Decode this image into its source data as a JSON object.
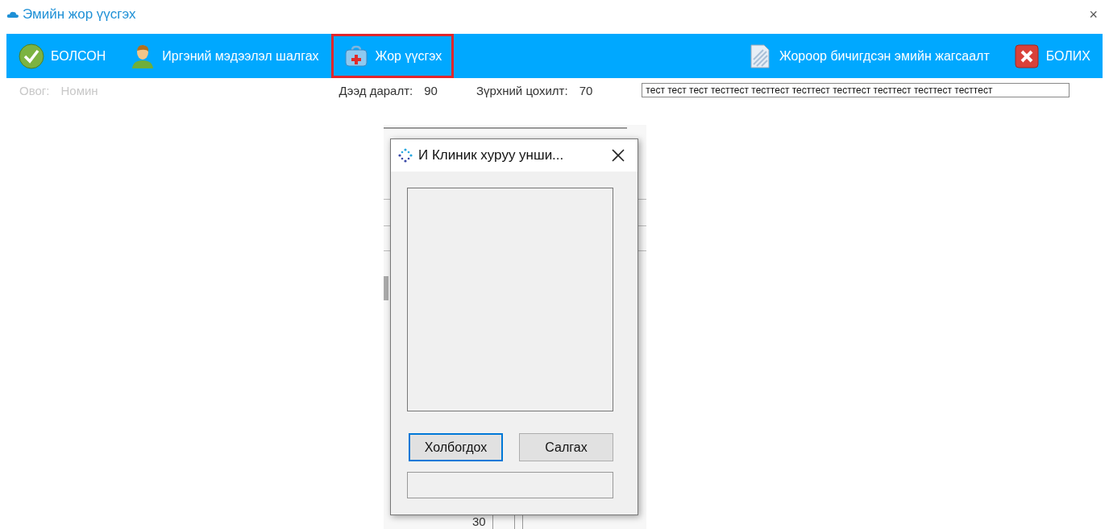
{
  "window": {
    "title": "Эмийн жор үүсгэх",
    "close": "×"
  },
  "toolbar": {
    "left": [
      {
        "kind": "done",
        "label": "БОЛСОН",
        "highlighted": false
      },
      {
        "kind": "person",
        "label": "Иргэний мэдээлэл шалгах",
        "highlighted": false
      },
      {
        "kind": "medkit",
        "label": "Жор үүсгэх",
        "highlighted": true
      }
    ],
    "right": [
      {
        "kind": "document",
        "label": "Жороор бичигдсэн эмийн жагсаалт",
        "highlighted": false
      },
      {
        "kind": "cancel",
        "label": "БОЛИХ",
        "highlighted": false
      }
    ]
  },
  "info": {
    "fields": [
      {
        "label": "Овог:",
        "value": "Номин",
        "faded": true
      },
      {
        "label": "Дээд даралт:",
        "value": "90",
        "faded": false
      },
      {
        "label": "Зүрхний цохилт:",
        "value": "70",
        "faded": false
      }
    ],
    "note": "тест тест тест тесттест тесттест тесттест тесттест тесттест тесттест тесттест"
  },
  "background_fragment": {
    "cell": "30"
  },
  "dialog": {
    "title": "И Клиник хуруу унши...",
    "buttons": [
      {
        "label": "Холбогдох",
        "focused": true
      },
      {
        "label": "Салгах",
        "focused": false
      }
    ]
  }
}
